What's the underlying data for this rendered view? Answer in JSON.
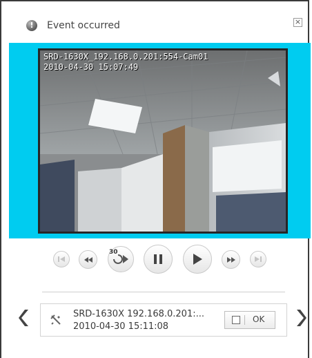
{
  "dialog": {
    "title": "Event occurred",
    "close_symbol": "×"
  },
  "video": {
    "camera_label": "SRD-1630X_192.168.0.201:554-Cam01",
    "timestamp": "2010-04-30 15:07:49"
  },
  "controls": [
    {
      "name": "prev-frame-button",
      "icon": "step-back-icon"
    },
    {
      "name": "rewind-button",
      "icon": "rewind-icon"
    },
    {
      "name": "replay-30-button",
      "icon": "replay-30-icon",
      "label": "30"
    },
    {
      "name": "pause-button",
      "icon": "pause-icon"
    },
    {
      "name": "play-button",
      "icon": "play-icon"
    },
    {
      "name": "fast-forward-button",
      "icon": "fast-forward-icon"
    },
    {
      "name": "next-frame-button",
      "icon": "step-forward-icon"
    }
  ],
  "event": {
    "icon": "tool-icon",
    "source": "SRD-1630X  192.168.0.201:...",
    "time": "2010-04-30 15:11:08",
    "ok_label": "OK"
  },
  "colors": {
    "panel_bg": "#00ccf0",
    "frame_border": "#262626"
  }
}
